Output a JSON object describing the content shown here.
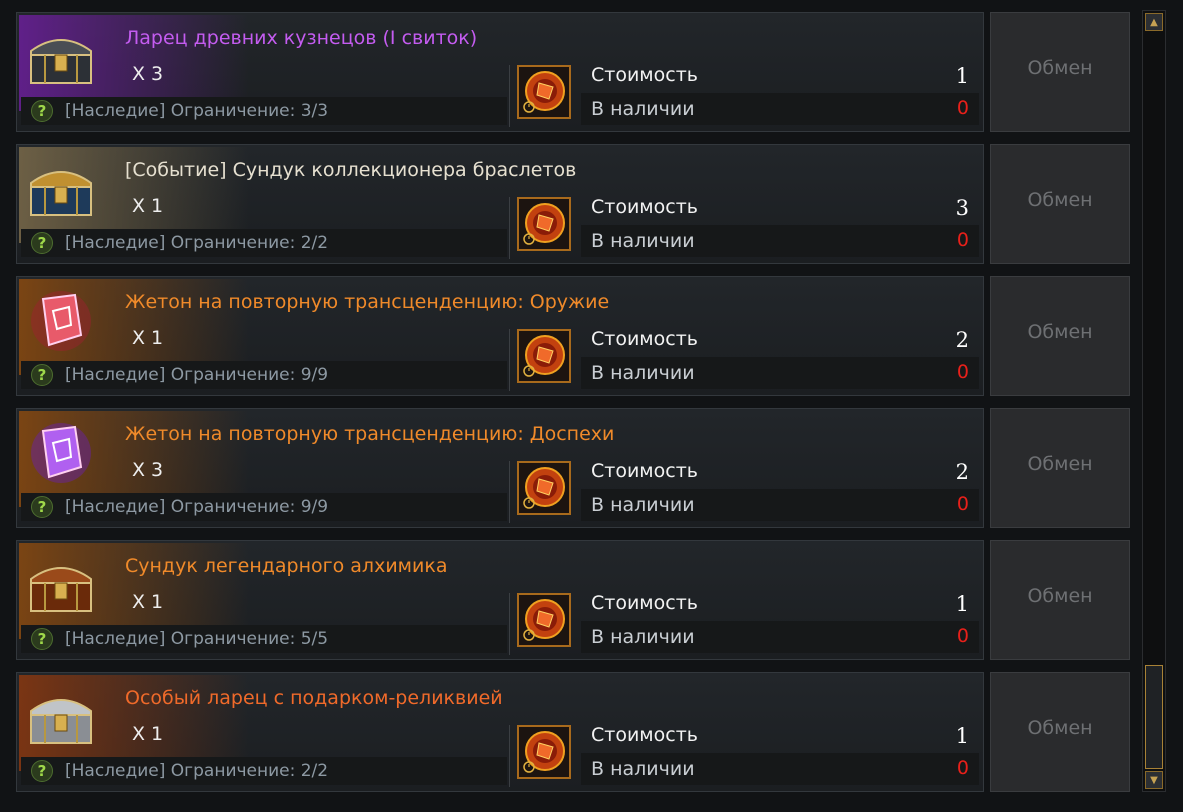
{
  "exchange_label": "Обмен",
  "cost_label": "Стоимость",
  "stock_label": "В наличии",
  "help_symbol": "?",
  "items": [
    {
      "name": "Ларец древних кузнецов (I свиток)",
      "name_color": "#c45cf0",
      "glow": "#6b1f9a",
      "icon": "chest-icon",
      "qty": "X 3",
      "limit": "[Наследие] Ограничение: 3/3",
      "cost": "1",
      "stock": "0"
    },
    {
      "name": "[Событие] Сундук коллекционера браслетов",
      "name_color": "#e6e0d0",
      "glow": "#7a6a4a",
      "icon": "chest-icon",
      "qty": "X 1",
      "limit": "[Наследие] Ограничение: 2/2",
      "cost": "3",
      "stock": "0"
    },
    {
      "name": "Жетон на повторную трансценденцию: Оружие",
      "name_color": "#f08a2a",
      "glow": "#8a4a10",
      "icon": "token-icon",
      "qty": "X 1",
      "limit": "[Наследие] Ограничение: 9/9",
      "cost": "2",
      "stock": "0"
    },
    {
      "name": "Жетон на повторную трансценденцию: Доспехи",
      "name_color": "#f08a2a",
      "glow": "#8a4a10",
      "icon": "token-icon",
      "qty": "X 3",
      "limit": "[Наследие] Ограничение: 9/9",
      "cost": "2",
      "stock": "0"
    },
    {
      "name": "Сундук легендарного алхимика",
      "name_color": "#f08a2a",
      "glow": "#8a4a10",
      "icon": "chest-icon",
      "qty": "X 1",
      "limit": "[Наследие] Ограничение: 5/5",
      "cost": "1",
      "stock": "0"
    },
    {
      "name": "Особый ларец с подарком-реликвией",
      "name_color": "#f06a2a",
      "glow": "#8a3810",
      "icon": "chest-icon",
      "qty": "X 1",
      "limit": "[Наследие] Ограничение: 2/2",
      "cost": "1",
      "stock": "0"
    }
  ]
}
